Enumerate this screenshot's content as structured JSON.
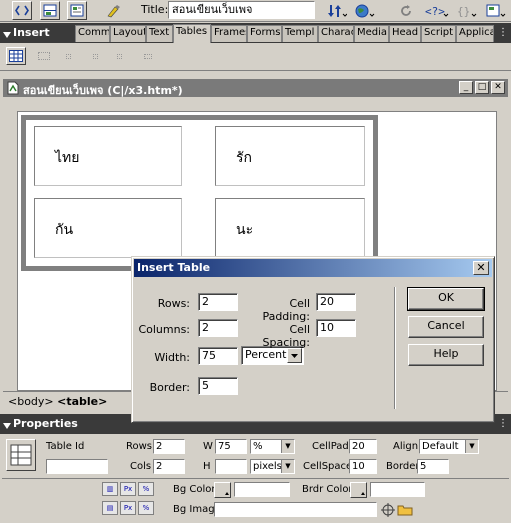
{
  "toolbar": {
    "title_label": "Title:",
    "title_value": "สอนเขียนเว็บเพจ",
    "icons": [
      "code-view-icon",
      "split-view-icon",
      "design-view-icon",
      "live-data-icon",
      "file-management-icon",
      "preview-browser-icon",
      "refresh-icon",
      "reference-icon",
      "code-navigation-icon",
      "view-options-icon"
    ]
  },
  "insert_bar": {
    "title": "Insert",
    "tabs": [
      "Comm",
      "Layout",
      "Text",
      "Tables",
      "Frames",
      "Forms",
      "Templ",
      "Charac",
      "Media",
      "Head",
      "Script",
      "Applica"
    ],
    "active_tab": "Tables"
  },
  "document": {
    "title": "สอนเขียนเว็บเพจ (C|/x3.htm*)",
    "cells": [
      "ไทย",
      "รัก",
      "กัน",
      "นะ"
    ]
  },
  "status_bar": {
    "body_tag": "<body>",
    "table_tag": "<table>"
  },
  "dialog": {
    "title": "Insert Table",
    "close_glyph": "✕",
    "rows_label": "Rows:",
    "rows_value": "2",
    "columns_label": "Columns:",
    "columns_value": "2",
    "width_label": "Width:",
    "width_value": "75",
    "width_unit": "Percent",
    "border_label": "Border:",
    "border_value": "5",
    "cell_padding_label": "Cell Padding:",
    "cell_padding_value": "20",
    "cell_spacing_label": "Cell Spacing:",
    "cell_spacing_value": "10",
    "ok_label": "OK",
    "cancel_label": "Cancel",
    "help_label": "Help"
  },
  "properties": {
    "title": "Properties",
    "table_id_label": "Table Id",
    "table_id_value": "",
    "rows_label": "Rows",
    "rows_value": "2",
    "cols_label": "Cols",
    "cols_value": "2",
    "w_label": "W",
    "w_value": "75",
    "w_unit": "%",
    "h_label": "H",
    "h_value": "",
    "h_unit": "pixels",
    "cellpad_label": "CellPad",
    "cellpad_value": "20",
    "cellspace_label": "CellSpace",
    "cellspace_value": "10",
    "align_label": "Align",
    "align_value": "Default",
    "border_label": "Border",
    "border_value": "5",
    "bgcolor_label": "Bg Color",
    "brdrcolor_label": "Brdr Color",
    "bgimage_label": "Bg Image",
    "bgimage_value": ""
  }
}
